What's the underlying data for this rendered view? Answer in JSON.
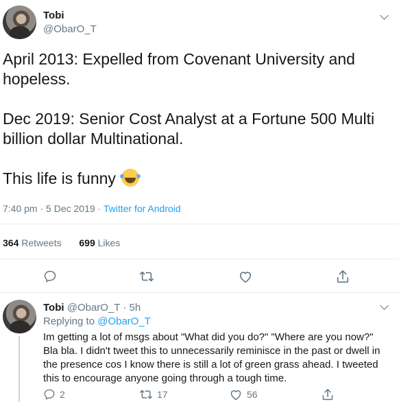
{
  "tweet": {
    "author_name": "Tobi",
    "author_handle": "@ObarO_T",
    "text": "April 2013: Expelled from Covenant University and hopeless.\n\nDec 2019: Senior Cost Analyst at a Fortune 500 Multi billion dollar Multinational.\n\nThis life is funny",
    "emoji": "face-with-tears-of-joy",
    "time": "7:40 pm",
    "date": "5 Dec 2019",
    "separator": "·",
    "source": "Twitter for Android",
    "retweets_count": "364",
    "retweets_label": "Retweets",
    "likes_count": "699",
    "likes_label": "Likes"
  },
  "actions": {
    "reply_icon": "comment-icon",
    "retweet_icon": "retweet-icon",
    "like_icon": "heart-icon",
    "share_icon": "share-icon"
  },
  "reply": {
    "author_name": "Tobi",
    "author_handle": "@ObarO_T",
    "separator": "·",
    "age": "5h",
    "replying_label": "Replying to",
    "replying_to": "@ObarO_T",
    "text": "Im getting a lot of msgs about \"What did you do?\" \"Where are you now?\" Bla bla. I didn't tweet this to unnecessarily reminisce in the past or dwell in the presence cos I know there is still a lot of green grass ahead. I tweeted this to encourage anyone going through a tough time.",
    "reply_count": "2",
    "retweet_count": "17",
    "like_count": "56"
  },
  "colors": {
    "accent": "#1da1f2",
    "secondary_text": "#657786",
    "divider": "#e6ecf0"
  }
}
